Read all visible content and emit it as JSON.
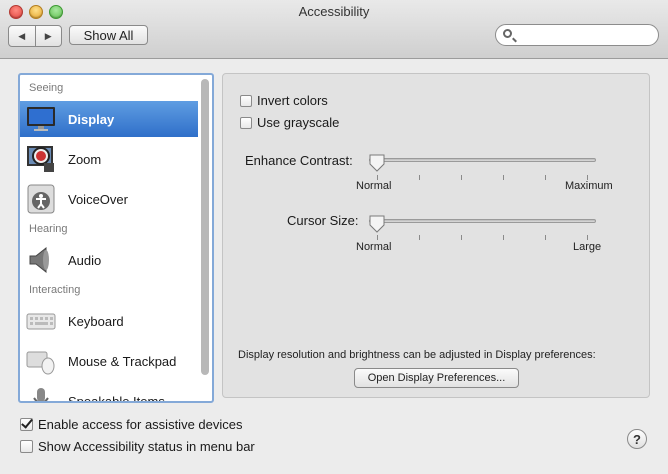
{
  "window": {
    "title": "Accessibility"
  },
  "toolbar": {
    "back_glyph": "◀",
    "forward_glyph": "▶",
    "show_all_label": "Show All",
    "search_placeholder": ""
  },
  "sidebar": {
    "groups": [
      {
        "header": "Seeing",
        "items": [
          {
            "label": "Display",
            "icon": "display-icon",
            "selected": true
          },
          {
            "label": "Zoom",
            "icon": "zoom-icon"
          },
          {
            "label": "VoiceOver",
            "icon": "voiceover-icon"
          }
        ]
      },
      {
        "header": "Hearing",
        "items": [
          {
            "label": "Audio",
            "icon": "speaker-icon"
          }
        ]
      },
      {
        "header": "Interacting",
        "items": [
          {
            "label": "Keyboard",
            "icon": "keyboard-icon"
          },
          {
            "label": "Mouse & Trackpad",
            "icon": "mouse-icon"
          },
          {
            "label": "Speakable Items",
            "icon": "microphone-icon"
          }
        ]
      }
    ]
  },
  "display": {
    "invert_colors": {
      "label": "Invert colors",
      "checked": false
    },
    "use_grayscale": {
      "label": "Use grayscale",
      "checked": false
    },
    "enhance_contrast": {
      "label": "Enhance Contrast:",
      "min_label": "Normal",
      "max_label": "Maximum",
      "value": 0
    },
    "cursor_size": {
      "label": "Cursor Size:",
      "min_label": "Normal",
      "max_label": "Large",
      "value": 0
    },
    "note": "Display resolution and brightness can be adjusted in Display preferences:",
    "open_button": "Open Display Preferences..."
  },
  "footer": {
    "assistive": {
      "label": "Enable access for assistive devices",
      "checked": true
    },
    "menubar": {
      "label": "Show Accessibility status in menu bar",
      "checked": false
    },
    "help_glyph": "?"
  },
  "colors": {
    "selection": "#3a7bd5",
    "focus_ring": "#84a9d8"
  }
}
